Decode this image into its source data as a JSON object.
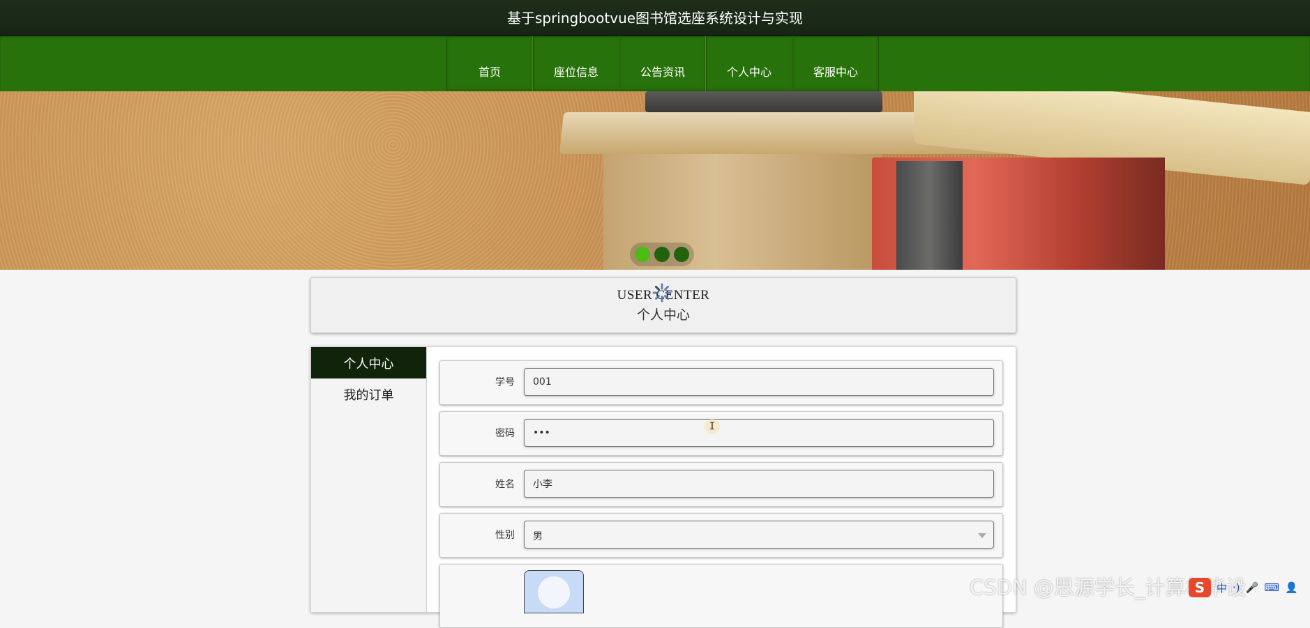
{
  "header": {
    "site_title": "基于springbootvue图书馆选座系统设计与实现"
  },
  "nav": {
    "items": [
      {
        "label": "首页"
      },
      {
        "label": "座位信息"
      },
      {
        "label": "公告资讯"
      },
      {
        "label": "个人中心"
      },
      {
        "label": "客服中心"
      }
    ]
  },
  "banner": {
    "active_slide": 1,
    "slide_count": 3
  },
  "user_center": {
    "title_en": "USER CENTER",
    "title_cn": "个人中心"
  },
  "sidebar": {
    "items": [
      {
        "label": "个人中心",
        "active": true
      },
      {
        "label": "我的订单",
        "active": false
      }
    ]
  },
  "form": {
    "student_id": {
      "label": "学号",
      "value": "001"
    },
    "password": {
      "label": "密码",
      "value": "•••"
    },
    "name": {
      "label": "姓名",
      "value": "小李"
    },
    "gender": {
      "label": "性别",
      "value": "男"
    }
  },
  "watermark": {
    "text": "CSDN @思源学长_计算机毕设"
  },
  "ime": {
    "logo": "S",
    "items": [
      "中",
      "·)",
      "🎤",
      "⌨",
      "👤"
    ]
  },
  "colors": {
    "title_bar": "#1b2a18",
    "nav_bar": "#28720b",
    "sidebar_active": "#0f240a",
    "dot_active": "#4dbb14",
    "dot_inactive": "#22620c"
  }
}
